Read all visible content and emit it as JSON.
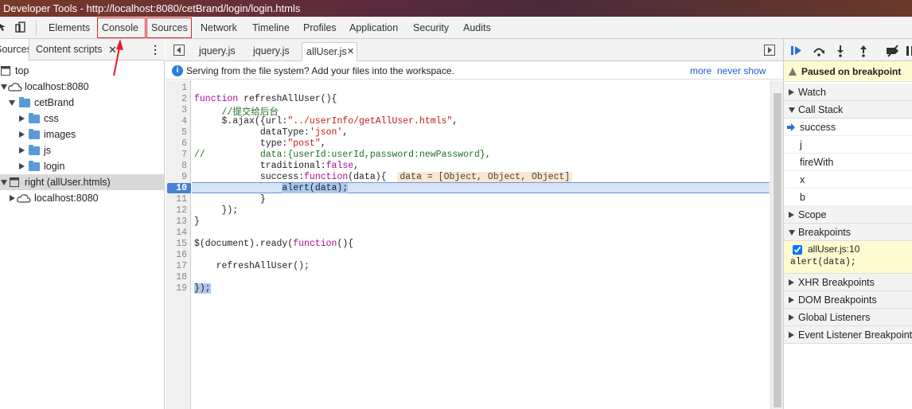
{
  "window": {
    "title": "Developer Tools - http://localhost:8080/cetBrand/login/login.htmls"
  },
  "toolbar": {
    "tabs": [
      "Elements",
      "Console",
      "Sources",
      "Network",
      "Timeline",
      "Profiles",
      "Application",
      "Security",
      "Audits"
    ]
  },
  "navigator": {
    "tabs": [
      "Sources",
      "Content scripts"
    ],
    "tree": [
      "top",
      "localhost:8080",
      "cetBrand",
      "css",
      "images",
      "js",
      "login",
      "right (allUser.htmls)",
      "localhost:8080"
    ]
  },
  "editor": {
    "tabs": [
      "jquery.js",
      "jquery.js",
      "allUser.js"
    ],
    "infobar": {
      "message": "Serving from the file system? Add your files into the workspace.",
      "more": "more",
      "never_show": "never show"
    },
    "line_numbers": [
      "1",
      "2",
      "3",
      "4",
      "5",
      "6",
      "7",
      "8",
      "9",
      "10",
      "11",
      "12",
      "13",
      "14",
      "15",
      "16",
      "17",
      "18",
      "19"
    ],
    "current_line": "10",
    "inline_value": "data = [Object, Object, Object]"
  },
  "debugger": {
    "paused_message": "Paused on breakpoint",
    "sections": [
      "Watch",
      "Call Stack",
      "Scope",
      "Breakpoints",
      "XHR Breakpoints",
      "DOM Breakpoints",
      "Global Listeners",
      "Event Listener Breakpoints"
    ],
    "call_stack": [
      "success",
      "j",
      "fireWith",
      "x",
      "b"
    ],
    "breakpoint": {
      "location": "allUser.js:10",
      "code": "alert(data);",
      "checked": true
    }
  },
  "colors": {
    "annotation": "#e0202a",
    "current_line": "#d6e4f7",
    "paused_bg": "#fffbd0"
  }
}
